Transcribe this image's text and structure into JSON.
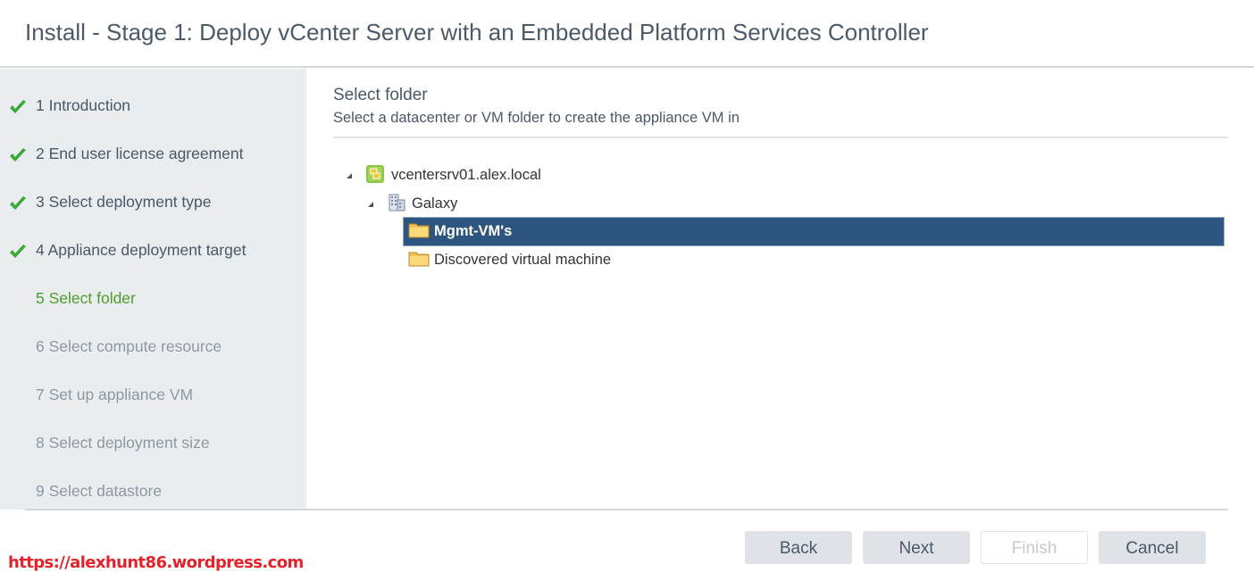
{
  "window": {
    "title": "Install - Stage 1: Deploy vCenter Server with an Embedded Platform Services Controller"
  },
  "sidebar": {
    "steps": [
      {
        "label": "1 Introduction",
        "state": "done",
        "icon": "check-icon"
      },
      {
        "label": "2 End user license agreement",
        "state": "done",
        "icon": "check-icon"
      },
      {
        "label": "3 Select deployment type",
        "state": "done",
        "icon": "check-icon"
      },
      {
        "label": "4 Appliance deployment target",
        "state": "done",
        "icon": "check-icon"
      },
      {
        "label": "5 Select folder",
        "state": "current"
      },
      {
        "label": "6 Select compute resource",
        "state": "future"
      },
      {
        "label": "7 Set up appliance VM",
        "state": "future"
      },
      {
        "label": "8 Select deployment size",
        "state": "future"
      },
      {
        "label": "9 Select datastore",
        "state": "future"
      }
    ]
  },
  "main": {
    "section_title": "Select folder",
    "section_subtitle": "Select a datacenter or VM folder to create the appliance VM in",
    "tree": {
      "root": {
        "label": "vcentersrv01.alex.local",
        "icon": "vcenter-server-icon",
        "expanded": true
      },
      "datacenter": {
        "label": "Galaxy",
        "icon": "datacenter-icon",
        "expanded": true
      },
      "folders": [
        {
          "label": "Mgmt-VM's",
          "icon": "folder-icon",
          "selected": true
        },
        {
          "label": "Discovered virtual machine",
          "icon": "folder-icon",
          "selected": false
        }
      ]
    }
  },
  "footer": {
    "back_label": "Back",
    "next_label": "Next",
    "finish_label": "Finish",
    "cancel_label": "Cancel",
    "finish_enabled": false
  },
  "watermark": "https://alexhunt86.wordpress.com",
  "colors": {
    "current_step": "#4e9c2a",
    "check": "#3aa935",
    "selection": "#2d557f",
    "watermark": "#e4222a"
  }
}
